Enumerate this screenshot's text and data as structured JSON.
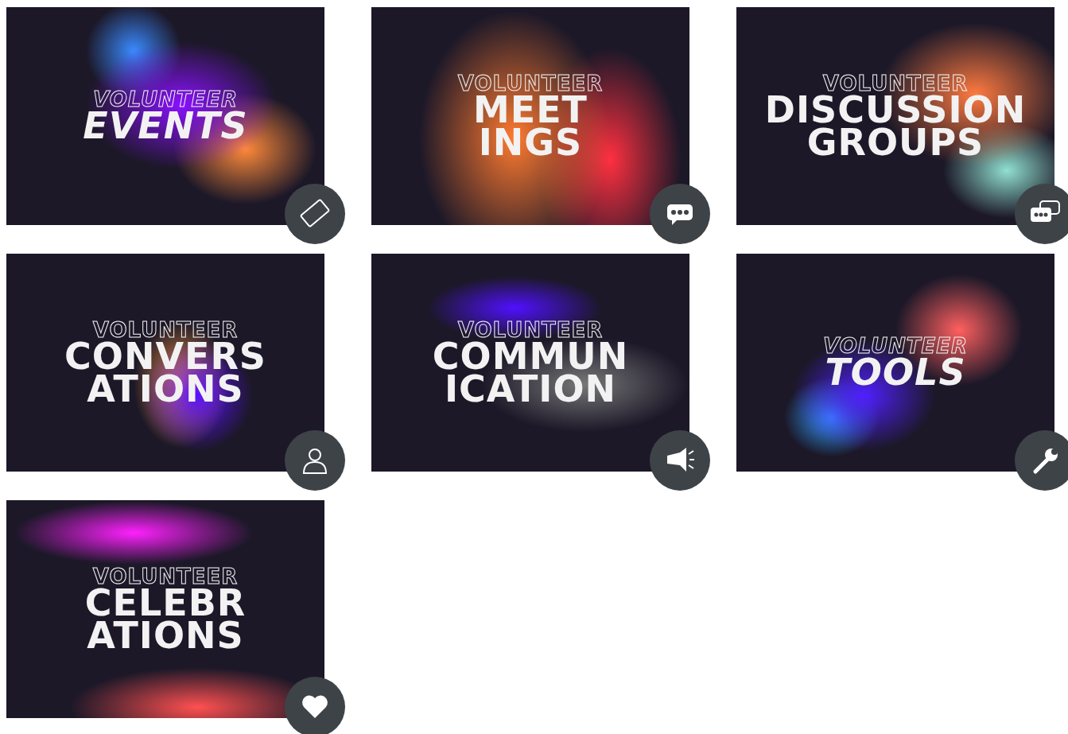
{
  "tiles": [
    {
      "kicker": "VOLUNTEER",
      "title_lines": [
        "EVENTS"
      ],
      "italic": true
    },
    {
      "kicker": "VOLUNTEER",
      "title_lines": [
        "MEET",
        "INGS"
      ],
      "italic": false
    },
    {
      "kicker": "VOLUNTEER",
      "title_lines": [
        "DISCUSSION",
        "GROUPS"
      ],
      "italic": false
    },
    {
      "kicker": "VOLUNTEER",
      "title_lines": [
        "CONVERS",
        "ATIONS"
      ],
      "italic": false
    },
    {
      "kicker": "VOLUNTEER",
      "title_lines": [
        "COMMUN",
        "ICATION"
      ],
      "italic": false
    },
    {
      "kicker": "VOLUNTEER",
      "title_lines": [
        "TOOLS"
      ],
      "italic": true
    },
    {
      "kicker": "VOLUNTEER",
      "title_lines": [
        "CELEBR",
        "ATIONS"
      ],
      "italic": false
    }
  ]
}
